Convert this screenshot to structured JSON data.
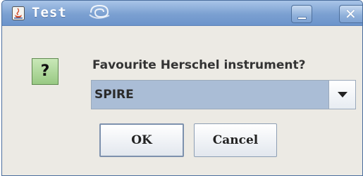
{
  "window": {
    "title": "Test"
  },
  "titlebar": {
    "minimize_icon": "minimize-icon",
    "close_glyph": "✕"
  },
  "dialog": {
    "icon": "question-icon",
    "icon_glyph": "?",
    "prompt": "Favourite Herschel instrument?",
    "selected_value": "SPIRE",
    "ok_label": "OK",
    "cancel_label": "Cancel"
  },
  "colors": {
    "titlebar": "#7ba0d1",
    "combo_selected_bg": "#aabdd6",
    "question_icon_bg": "#98c983",
    "window_bg": "#eceae4"
  }
}
